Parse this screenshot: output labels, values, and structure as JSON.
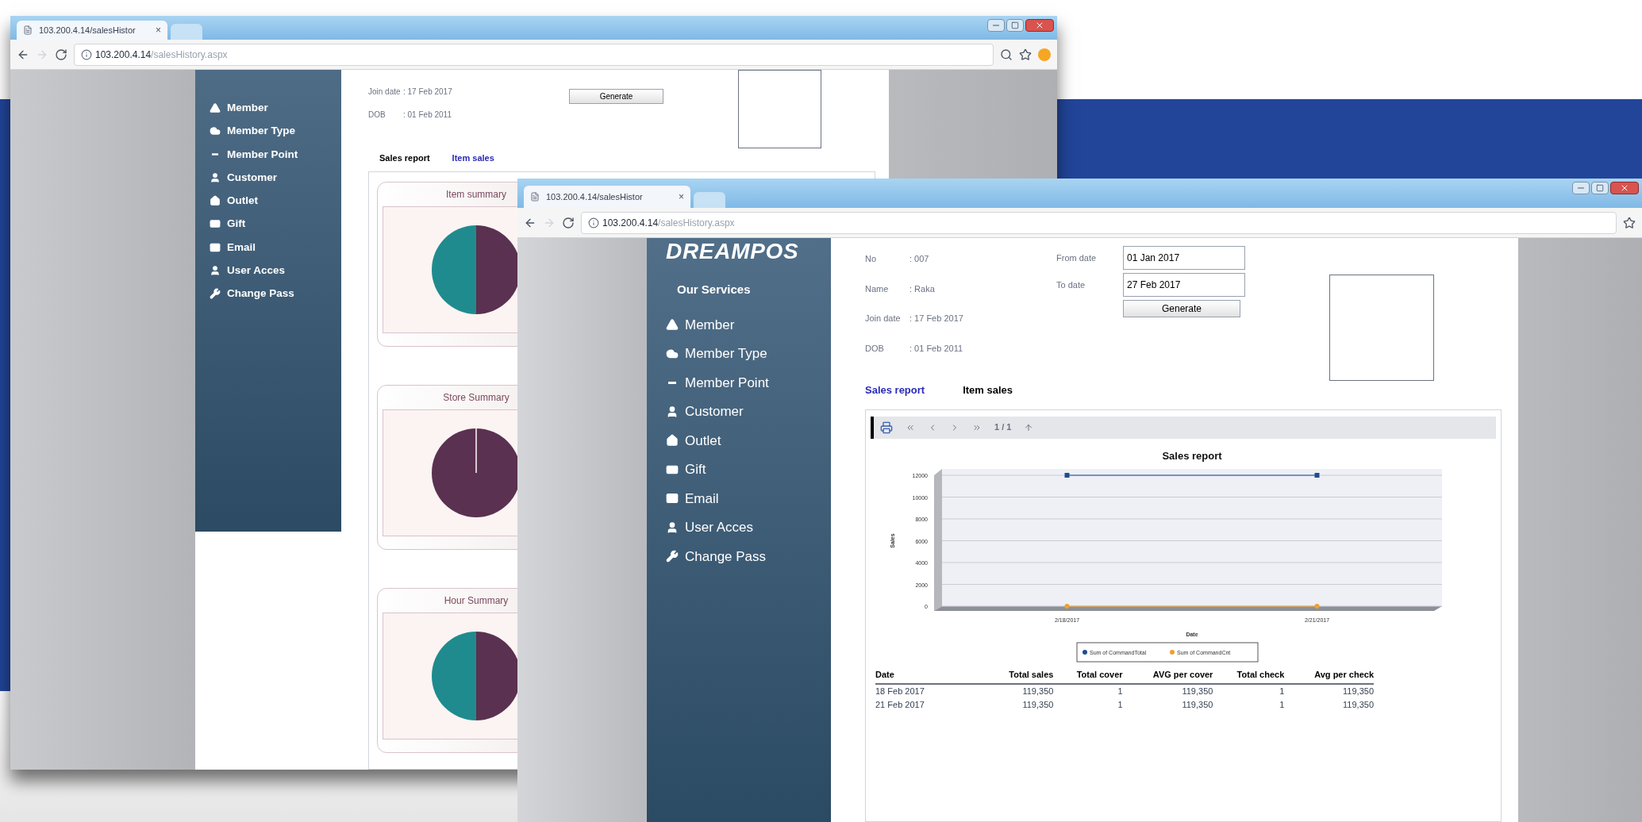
{
  "back_window": {
    "tab_title": "103.200.4.14/salesHistor",
    "tab_close": "×",
    "url_host": "103.200.4.14",
    "url_path": "/salesHistory.aspx",
    "sidebar": {
      "items": [
        {
          "label": "Member"
        },
        {
          "label": "Member Type"
        },
        {
          "label": "Member Point"
        },
        {
          "label": "Customer"
        },
        {
          "label": "Outlet"
        },
        {
          "label": "Gift"
        },
        {
          "label": "Email"
        },
        {
          "label": "User Acces"
        },
        {
          "label": "Change Pass"
        }
      ]
    },
    "member": [
      {
        "label": "Join date",
        "value": ": 17 Feb 2017"
      },
      {
        "label": "DOB",
        "value": ": 01 Feb 2011"
      }
    ],
    "generate_button": "Generate",
    "tabs": [
      {
        "label": "Sales report",
        "selected": false
      },
      {
        "label": "Item sales",
        "selected": true
      }
    ],
    "panels": [
      {
        "title": "Item summary",
        "kind": "split"
      },
      {
        "title": "Store Summary",
        "kind": "full"
      },
      {
        "title": "Hour Summary",
        "kind": "split"
      }
    ]
  },
  "front_window": {
    "tab_title": "103.200.4.14/salesHistor",
    "tab_close": "×",
    "url_host": "103.200.4.14",
    "url_path": "/salesHistory.aspx",
    "logo": "DREAMPOS",
    "services_heading": "Our Services",
    "sidebar": {
      "items": [
        {
          "label": "Member"
        },
        {
          "label": "Member Type"
        },
        {
          "label": "Member Point"
        },
        {
          "label": "Customer"
        },
        {
          "label": "Outlet"
        },
        {
          "label": "Gift"
        },
        {
          "label": "Email"
        },
        {
          "label": "User Acces"
        },
        {
          "label": "Change Pass"
        }
      ]
    },
    "member": [
      {
        "label": "No",
        "value": ": 007"
      },
      {
        "label": "Name",
        "value": ": Raka"
      },
      {
        "label": "Join date",
        "value": ": 17 Feb 2017"
      },
      {
        "label": "DOB",
        "value": ": 01 Feb 2011"
      }
    ],
    "date_filter": [
      {
        "label": "From date",
        "value": "01 Jan 2017"
      },
      {
        "label": "To date",
        "value": "27 Feb 2017"
      }
    ],
    "generate_button": "Generate",
    "tabs": [
      {
        "label": "Sales report",
        "selected": true
      },
      {
        "label": "Item sales",
        "selected": false
      }
    ],
    "report": {
      "page": "1 / 1",
      "chart_data": {
        "type": "line",
        "title": "Sales report",
        "xlabel": "Date",
        "ylabel": "Sales",
        "categories": [
          "2/18/2017",
          "2/21/2017"
        ],
        "grid": true,
        "legend": true,
        "series": [
          {
            "name": "Sum of CommandTotal",
            "color": "#1f4e8c",
            "marker": "square",
            "values": [
              12000,
              12000
            ]
          },
          {
            "name": "Sum of CommandCnt",
            "color": "#f0a030",
            "marker": "circle",
            "values": [
              0,
              0
            ]
          }
        ],
        "ylim": [
          0,
          12000
        ],
        "yticks": [
          0,
          2000,
          4000,
          6000,
          8000,
          10000,
          12000
        ]
      },
      "table": {
        "columns": [
          "Date",
          "Total sales",
          "Total cover",
          "AVG per cover",
          "Total check",
          "Avg per check"
        ],
        "rows": [
          [
            "18 Feb 2017",
            "119,350",
            "1",
            "119,350",
            "1",
            "119,350"
          ],
          [
            "21 Feb 2017",
            "119,350",
            "1",
            "119,350",
            "1",
            "119,350"
          ]
        ]
      }
    }
  }
}
